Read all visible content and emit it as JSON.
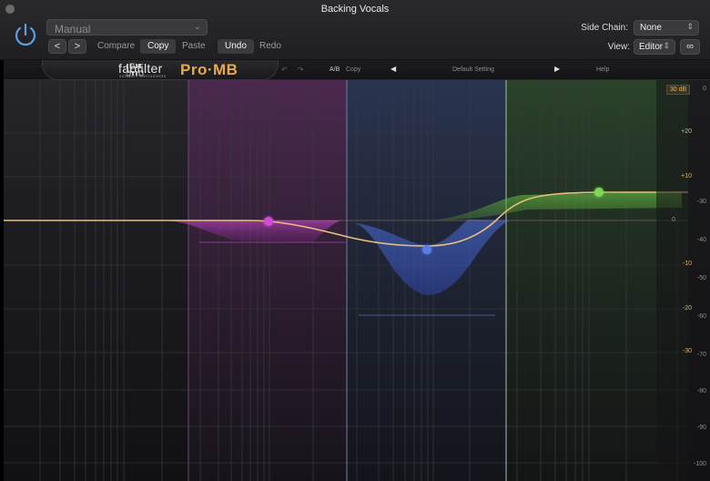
{
  "window": {
    "title": "Backing Vocals"
  },
  "host": {
    "preset": "Manual",
    "nav_back": "<",
    "nav_forward": ">",
    "compare": "Compare",
    "copy": "Copy",
    "paste": "Paste",
    "undo": "Undo",
    "redo": "Redo",
    "side_chain_label": "Side Chain:",
    "side_chain_value": "None",
    "view_label": "View:",
    "view_value": "Editor"
  },
  "plugin": {
    "brand": "fabfilter",
    "brand_sub": "software instruments",
    "product": "Pro·MB",
    "ab": "A/B",
    "copy": "Copy",
    "preset_name": "Default Setting",
    "help": "Help",
    "range": "30 dB",
    "gain_scale": [
      "+20",
      "+10",
      "0",
      "-10",
      "-20",
      "-30"
    ],
    "level_scale": [
      "-30",
      "-40",
      "-50",
      "-60",
      "-70",
      "-80",
      "-90",
      "-100"
    ],
    "level_scale_top": "0"
  },
  "bands": [
    {
      "name": "low",
      "color": "#d24bd6",
      "gain_db": -1.8
    },
    {
      "name": "mid",
      "color": "#5a7ee8",
      "gain_db": -8.5
    },
    {
      "name": "high",
      "color": "#7ed957",
      "gain_db": 2.9
    }
  ],
  "colors": {
    "accent": "#e9a948",
    "curve": "#e6c07a"
  }
}
